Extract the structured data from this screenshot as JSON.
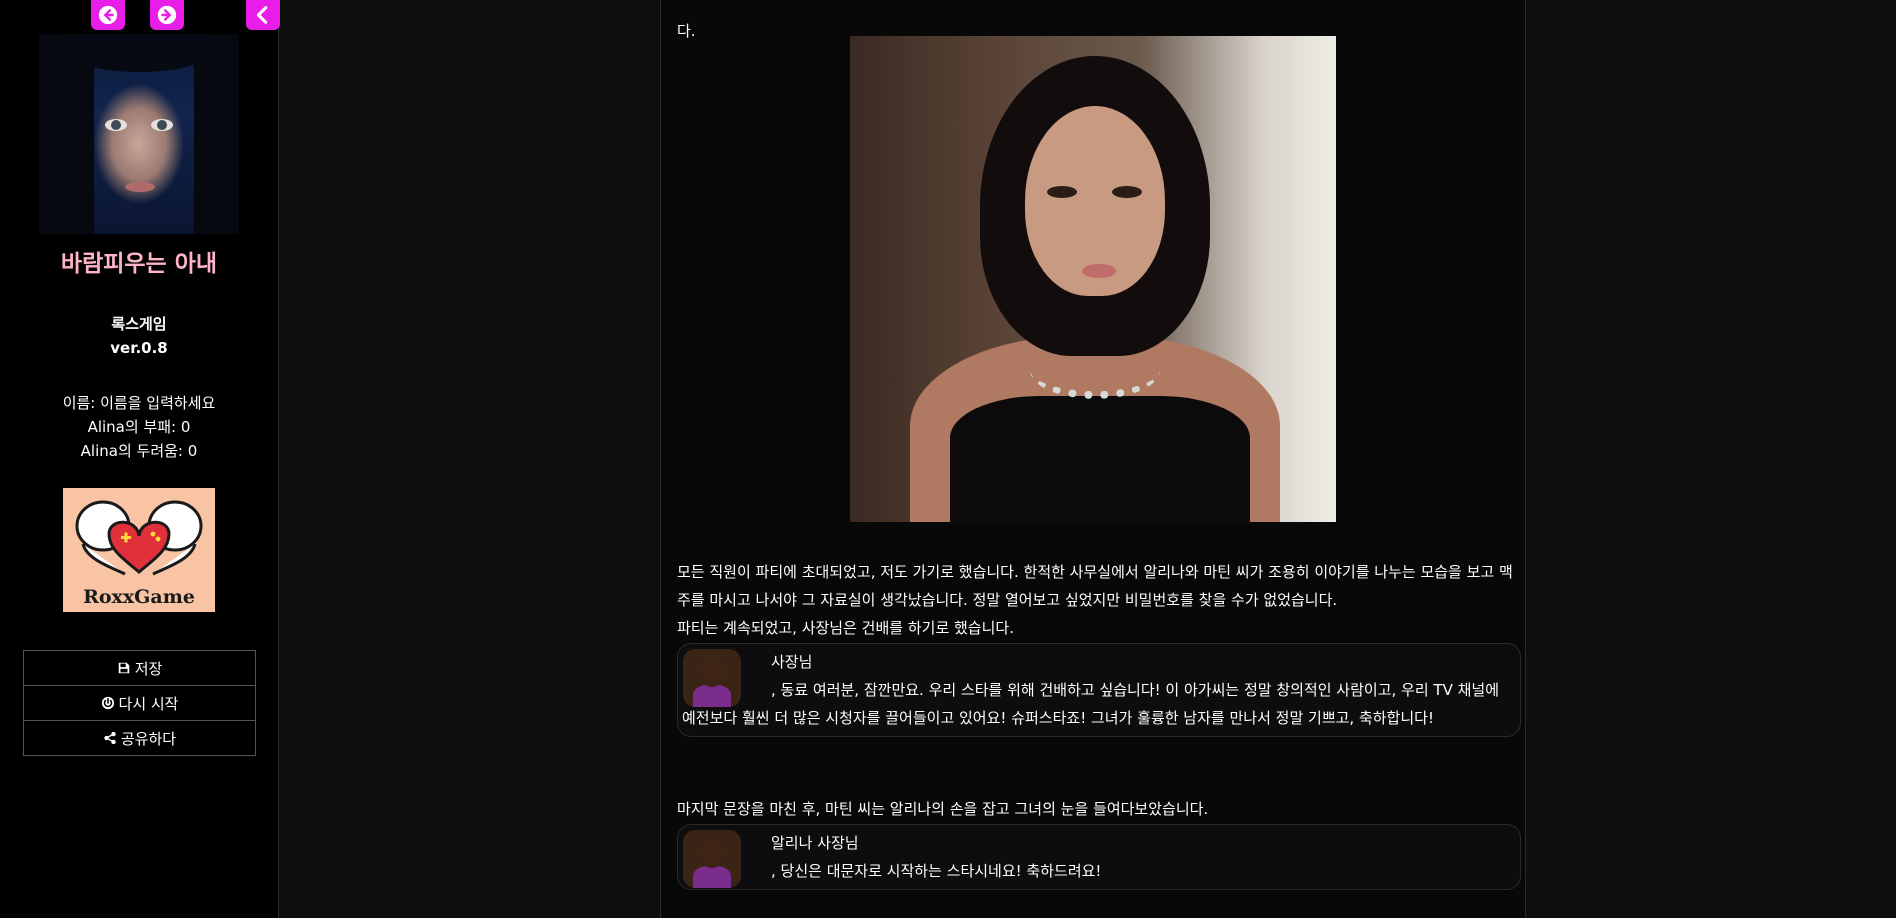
{
  "sidebar": {
    "game_title": "바람피우는 아내",
    "studio": "록스게임",
    "version": "ver.0.8",
    "stats": [
      "이름: 이름을 입력하세요",
      "Alina의 부패: 0",
      "Alina의 두려움: 0"
    ],
    "logo_text": "RoxxGame",
    "menu": {
      "save": "저장",
      "restart": "다시 시작",
      "share": "공유하다"
    }
  },
  "story": {
    "top_fragment": "다.",
    "paragraph1": "모든 직원이 파티에 초대되었고, 저도 가기로 했습니다. 한적한 사무실에서 알리나와 마틴 씨가 조용히 이야기를 나누는 모습을 보고 맥주를 마시고 나서야 그 자료실이 생각났습니다. 정말 열어보고 싶었지만 비밀번호를 찾을 수가 없었습니다.",
    "paragraph2": "파티는 계속되었고, 사장님은 건배를 하기로 했습니다.",
    "dialog1": {
      "speaker": "사장님",
      "text": ", 동료 여러분, 잠깐만요. 우리 스타를 위해 건배하고 싶습니다! 이 아가씨는 정말 창의적인 사람이고, 우리 TV 채널에 예전보다 훨씬 더 많은 시청자를 끌어들이고 있어요! 슈퍼스타죠! 그녀가 훌륭한 남자를 만나서 정말 기쁘고, 축하합니다!"
    },
    "paragraph3": "마지막 문장을 마친 후, 마틴 씨는 알리나의 손을 잡고 그녀의 눈을 들여다보았습니다.",
    "dialog2": {
      "speaker": "알리나 사장님",
      "text": ", 당신은 대문자로 시작하는 스타시네요! 축하드려요!"
    }
  },
  "colors": {
    "accent_pink": "#e81ee8",
    "title_pink": "#ffb3c6",
    "logo_bg": "#f8c4a3"
  },
  "icons": [
    "arrow-left-circle-icon",
    "arrow-right-circle-icon",
    "chevron-left-icon",
    "save-icon",
    "power-icon",
    "share-icon"
  ]
}
